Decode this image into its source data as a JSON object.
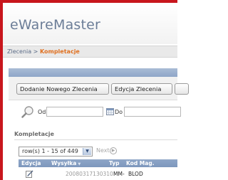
{
  "app": {
    "title": "eWareMaster"
  },
  "breadcrumb": {
    "parent": "Zlecenia",
    "separator": " > ",
    "current": "Kompletacje"
  },
  "toolbar": {
    "buttons": [
      {
        "label": "Dodanie Nowego Zlecenia"
      },
      {
        "label": "Edycja Zlecenia"
      }
    ]
  },
  "filter": {
    "from_label": "Od",
    "to_label": "Do",
    "icons": [
      "search-icon",
      "calendar-icon"
    ]
  },
  "section": {
    "title": "Kompletacje"
  },
  "pager": {
    "rows_select_value": "row(s) 1 - 15 of 449",
    "next_label": "Next"
  },
  "table": {
    "columns": [
      "Edycja",
      "Wysyłka",
      "Typ",
      "Kod Mag."
    ],
    "sort_column": "Wysyłka",
    "rows": [
      {
        "edit_icon": "edit-icon",
        "wysylka": "20080317130310",
        "typ": "MM-",
        "kod_mag": "BLOD"
      }
    ]
  },
  "colors": {
    "frame_red": "#c8161d",
    "title_blue_gray": "#6b7d97",
    "breadcrumb_current_orange": "#e07020",
    "header_blue": "#8ea6c8"
  }
}
